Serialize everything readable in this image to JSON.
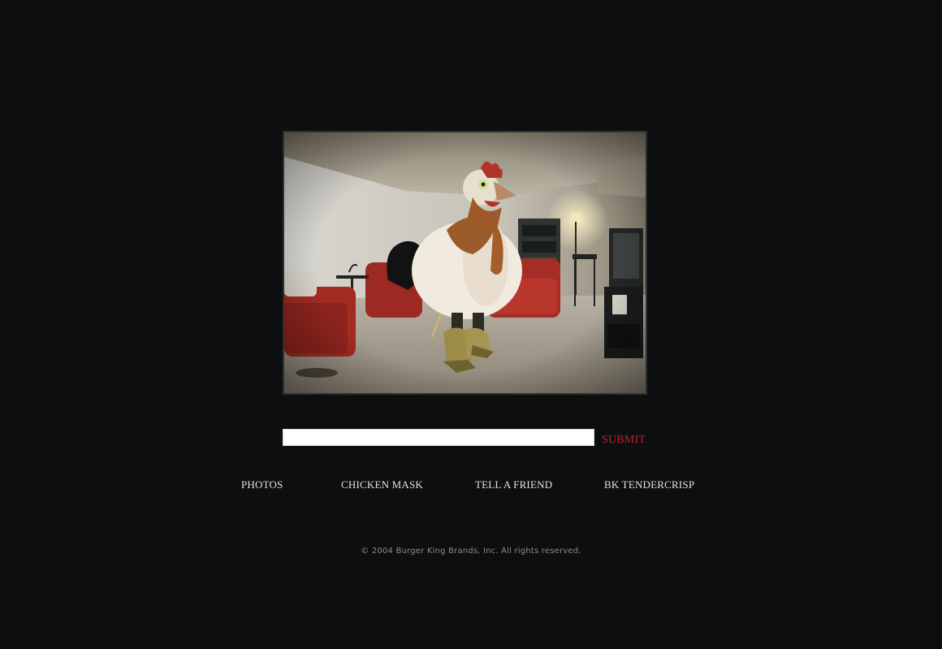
{
  "photo": {
    "subject": "person in chicken costume in a living room"
  },
  "input": {
    "value": "",
    "placeholder": ""
  },
  "submit_label": "SUBMIT",
  "nav": [
    {
      "label": "PHOTOS"
    },
    {
      "label": "CHICKEN MASK"
    },
    {
      "label": "TELL A FRIEND"
    },
    {
      "label": "BK TENDERCRISP"
    }
  ],
  "footer": {
    "copyright": "© 2004 Burger King Brands, Inc. All rights reserved."
  },
  "colors": {
    "background": "#0c0e0f",
    "submit": "#c4202f",
    "nav_text": "#e2e2e2",
    "footer_text": "#8d8d8d"
  }
}
